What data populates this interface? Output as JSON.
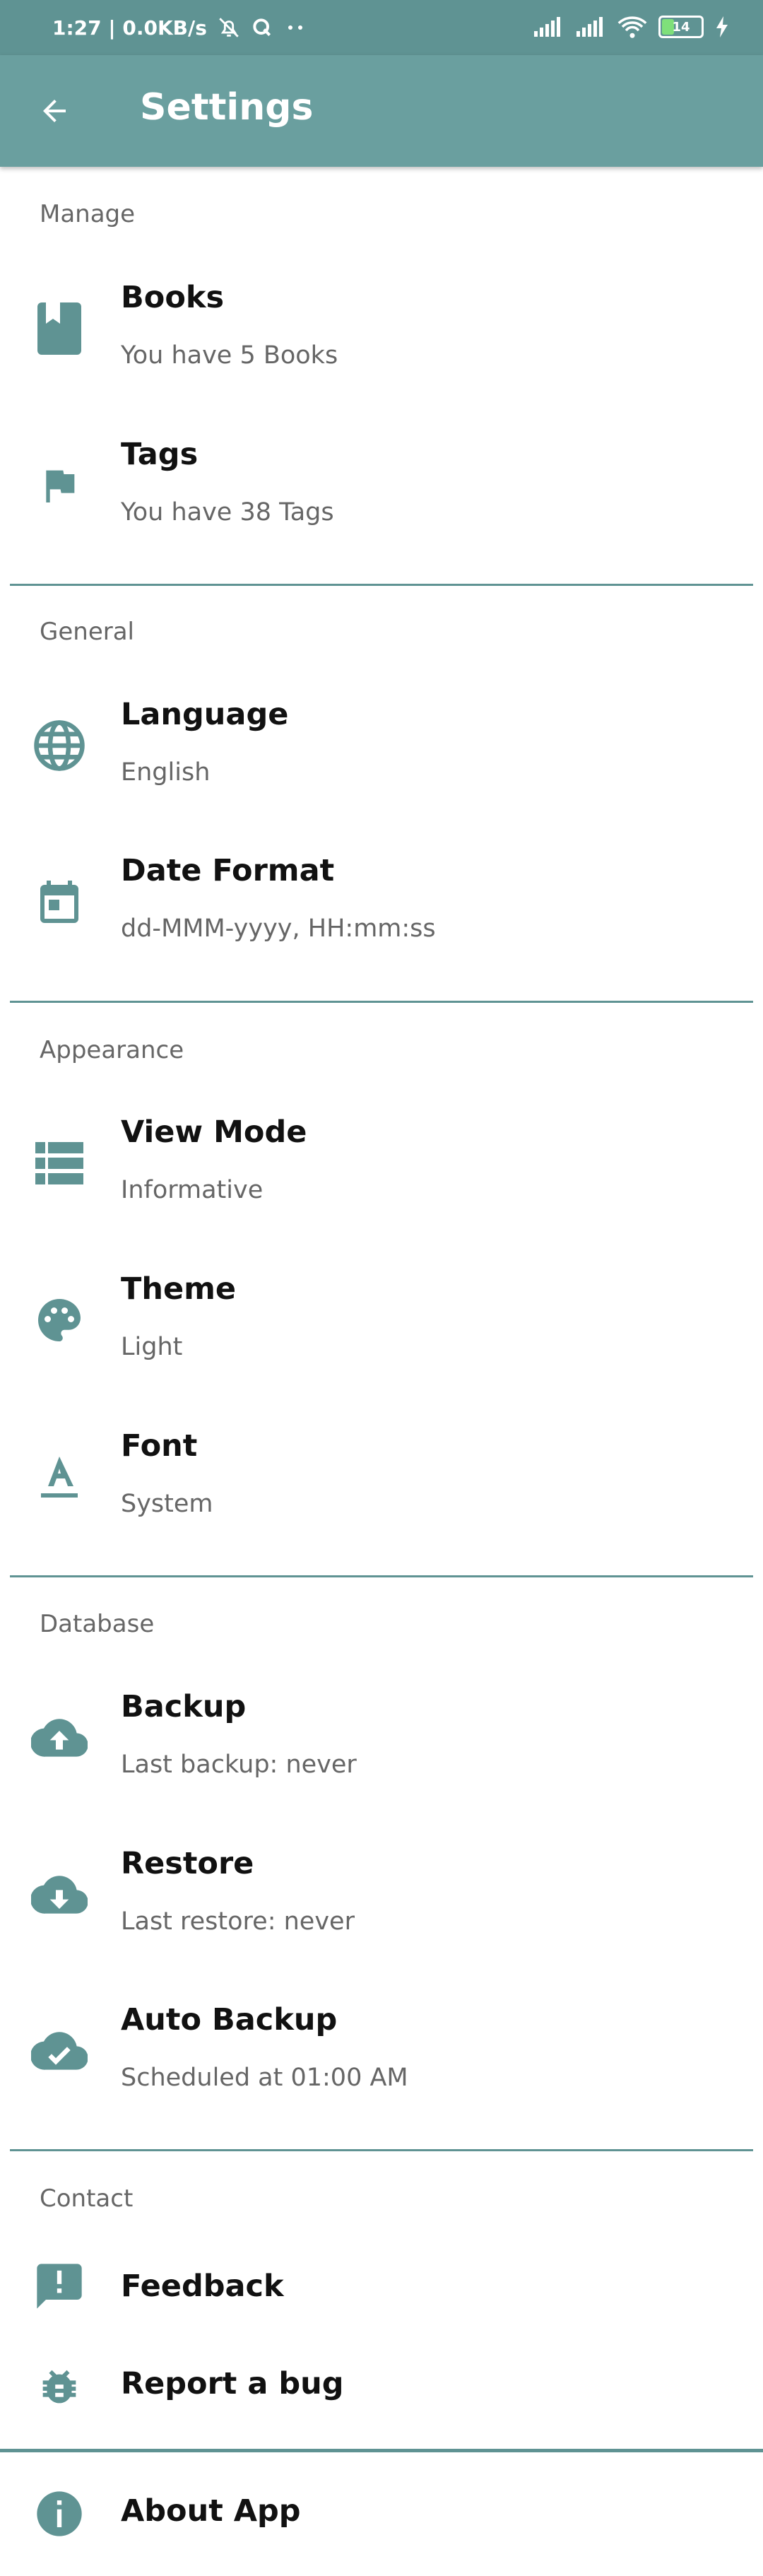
{
  "status_bar": {
    "time_speed": "1:27 | 0.0KB/s",
    "battery": "14"
  },
  "app_bar": {
    "title": "Settings"
  },
  "sections": {
    "manage": "Manage",
    "general": "General",
    "appearance": "Appearance",
    "database": "Database",
    "contact": "Contact"
  },
  "items": {
    "books": {
      "label": "Books",
      "sub": "You have 5 Books"
    },
    "tags": {
      "label": "Tags",
      "sub": "You have 38 Tags"
    },
    "language": {
      "label": "Language",
      "sub": "English"
    },
    "date_format": {
      "label": "Date Format",
      "sub": "dd-MMM-yyyy, HH:mm:ss"
    },
    "view_mode": {
      "label": "View Mode",
      "sub": "Informative"
    },
    "theme": {
      "label": "Theme",
      "sub": "Light"
    },
    "font": {
      "label": "Font",
      "sub": "System"
    },
    "backup": {
      "label": "Backup",
      "sub": "Last backup: never"
    },
    "restore": {
      "label": "Restore",
      "sub": "Last restore: never"
    },
    "auto_backup": {
      "label": "Auto Backup",
      "sub": "Scheduled at 01:00 AM"
    },
    "feedback": {
      "label": "Feedback"
    },
    "report_bug": {
      "label": "Report a bug"
    },
    "about": {
      "label": "About App"
    }
  },
  "colors": {
    "accent": "#6a9f9f",
    "icon": "#5f9393"
  }
}
